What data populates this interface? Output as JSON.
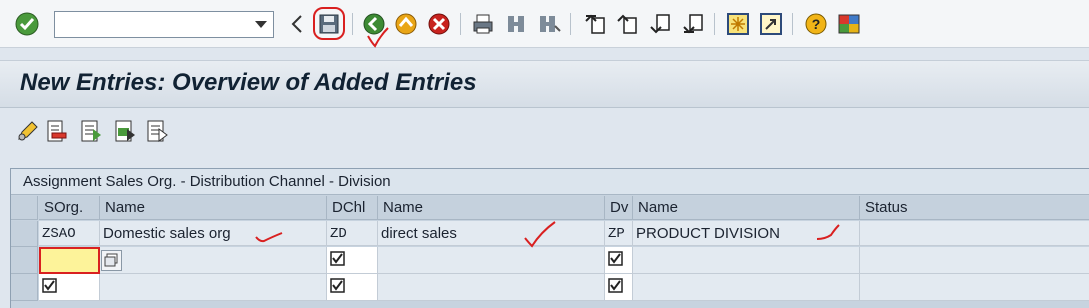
{
  "toolbar": {
    "command_field_value": "",
    "icons": [
      "enter-icon",
      "back-arrow-icon",
      "save-icon",
      "back-icon",
      "exit-icon",
      "cancel-icon",
      "print-icon",
      "find-icon",
      "find-next-icon",
      "first-page-icon",
      "previous-page-icon",
      "next-page-icon",
      "last-page-icon",
      "create-session-icon",
      "shortcut-icon",
      "help-icon",
      "customize-layout-icon"
    ]
  },
  "title": "New Entries: Overview of Added Entries",
  "app_toolbar": {
    "icons": [
      "change-display-icon",
      "delete-row-icon",
      "select-all-icon",
      "select-block-icon",
      "deselect-all-icon"
    ]
  },
  "table": {
    "title": "Assignment Sales Org. - Distribution Channel - Division",
    "columns": [
      "SOrg.",
      "Name",
      "DChl",
      "Name",
      "Dv",
      "Name",
      "Status"
    ],
    "rows": [
      {
        "sorg": "ZSAO",
        "sorg_name": "Domestic sales org",
        "dchl": "ZD",
        "dchl_name": "direct sales",
        "dv": "ZP",
        "dv_name": "PRODUCT DIVISION",
        "status": ""
      },
      {
        "sorg": "",
        "sorg_name": "",
        "dchl": "",
        "dchl_name": "",
        "dv": "",
        "dv_name": "",
        "status": ""
      },
      {
        "sorg": "",
        "sorg_name": "",
        "dchl": "",
        "dchl_name": "",
        "dv": "",
        "dv_name": "",
        "status": ""
      }
    ]
  },
  "colors": {
    "accent_red": "#d92020",
    "title_bar": "#d5dde6",
    "selected_cell": "#fdf39a"
  }
}
